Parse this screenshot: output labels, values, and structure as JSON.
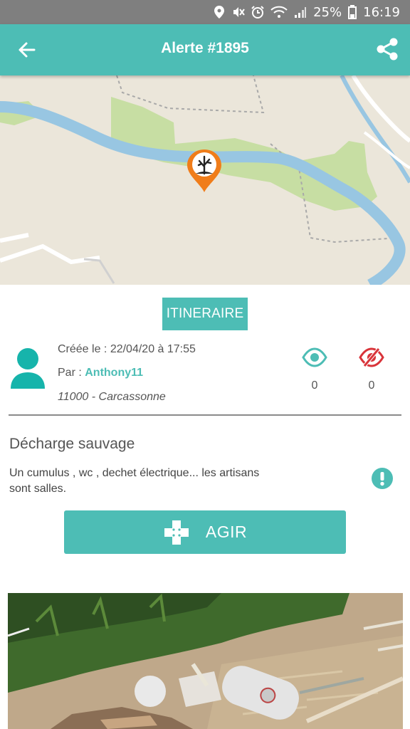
{
  "status_bar": {
    "battery_text": "25%",
    "time": "16:19",
    "icons": [
      "location-icon",
      "mute-icon",
      "alarm-icon",
      "wifi-icon",
      "signal-icon",
      "battery-icon"
    ]
  },
  "header": {
    "title": "Alerte #1895",
    "back_icon": "arrow-left-icon",
    "share_icon": "share-icon",
    "color": "#4dbdb5"
  },
  "map": {
    "marker_icon": "dead-tree-marker-icon",
    "marker_color": "#f07d1a"
  },
  "details": {
    "itinerary_label": "ITINERAIRE",
    "created": "Créée le : 22/04/20 à 17:55",
    "author_prefix": "Par : ",
    "author": "Anthony11",
    "location": "11000 - Carcassonne",
    "views_count": "0",
    "hidden_count": "0",
    "views_icon_color": "#4dbdb5",
    "hidden_icon_color": "#d9343a"
  },
  "report": {
    "category": "Décharge sauvage",
    "description": "Un cumulus , wc , dechet électrique... les artisans sont salles.",
    "warn_icon": "exclamation-icon"
  },
  "action": {
    "label": "AGIR",
    "icon": "bandage-icon"
  },
  "accent_color": "#4dbdb5"
}
